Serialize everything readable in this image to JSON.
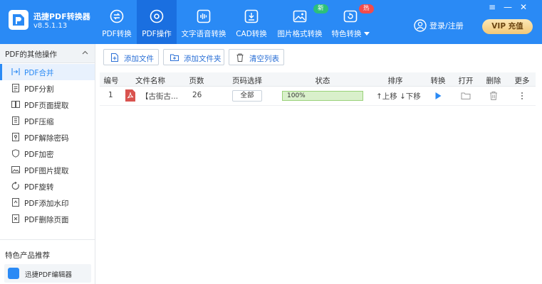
{
  "app": {
    "name": "迅捷PDF转换器",
    "version": "v8.5.1.13"
  },
  "top_nav": [
    {
      "label": "PDF转换",
      "icon": "refresh-convert-icon",
      "active": false
    },
    {
      "label": "PDF操作",
      "icon": "gear-icon",
      "active": true
    },
    {
      "label": "文字语音转换",
      "icon": "waveform-icon",
      "active": false
    },
    {
      "label": "CAD转换",
      "icon": "cad-icon",
      "active": false
    },
    {
      "label": "图片格式转换",
      "icon": "image-icon",
      "active": false,
      "badge": "新"
    },
    {
      "label": "特色转换",
      "icon": "special-convert-icon",
      "active": false,
      "badge": "热",
      "dropdown": true
    }
  ],
  "header": {
    "login_label": "登录/注册",
    "vip_label": "VIP 充值",
    "window_controls": [
      "≡",
      "—",
      "✕"
    ]
  },
  "colors": {
    "primary": "#2a8af5",
    "active_tab": "#1a6fe0",
    "badge_new": "#2cc07a",
    "badge_hot": "#f24b4b",
    "progress": "#d9f0cb"
  },
  "sidebar": {
    "section_title": "PDF的其他操作",
    "items": [
      {
        "label": "PDF合并",
        "icon": "merge-icon",
        "active": true
      },
      {
        "label": "PDF分割",
        "icon": "split-icon"
      },
      {
        "label": "PDF页面提取",
        "icon": "extract-page-icon"
      },
      {
        "label": "PDF压缩",
        "icon": "compress-icon"
      },
      {
        "label": "PDF解除密码",
        "icon": "unlock-icon"
      },
      {
        "label": "PDF加密",
        "icon": "shield-icon"
      },
      {
        "label": "PDF图片提取",
        "icon": "image-extract-icon"
      },
      {
        "label": "PDF旋转",
        "icon": "rotate-icon"
      },
      {
        "label": "PDF添加水印",
        "icon": "watermark-icon"
      },
      {
        "label": "PDF删除页面",
        "icon": "delete-page-icon"
      }
    ],
    "recommend_title": "特色产品推荐",
    "recommend_item": "迅捷PDF编辑器"
  },
  "toolbar": {
    "add_file": "添加文件",
    "add_folder": "添加文件夹",
    "clear_list": "清空列表"
  },
  "table": {
    "headers": [
      "编号",
      "文件名称",
      "页数",
      "页码选择",
      "状态",
      "排序",
      "转换",
      "打开",
      "删除",
      "更多"
    ],
    "rows": [
      {
        "index": "1",
        "filename": "【古街古...",
        "pages": "26",
        "page_range": "全部",
        "status": "100%",
        "progress": 1.0,
        "move_up": "↑上移",
        "move_down": "↓下移"
      }
    ]
  }
}
